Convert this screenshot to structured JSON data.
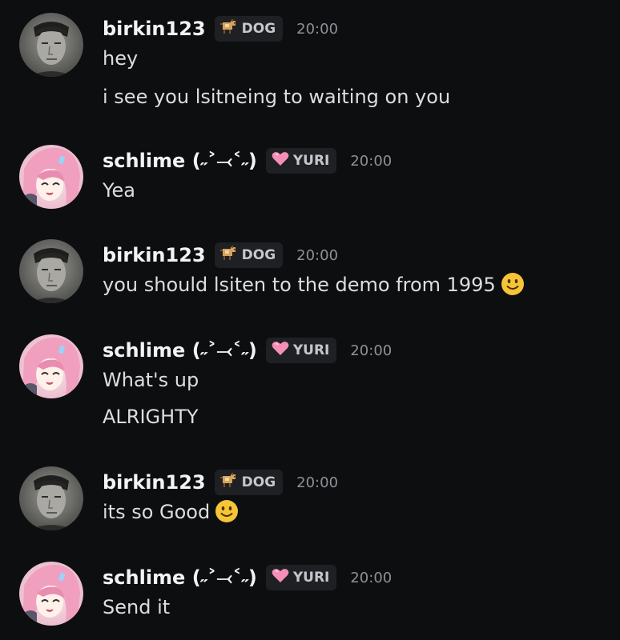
{
  "messages": [
    {
      "username": "birkin123",
      "tag": "DOG",
      "time": "20:00",
      "lines": [
        "hey",
        "i see you lsitneing to waiting on you"
      ]
    },
    {
      "username": "schlime (˶˃⤙˂˶)",
      "tag": "YURI",
      "time": "20:00",
      "lines": [
        "Yea"
      ]
    },
    {
      "username": "birkin123",
      "tag": "DOG",
      "time": "20:00",
      "lines": [
        "you should lsiten to the demo from 1995"
      ]
    },
    {
      "username": "schlime (˶˃⤙˂˶)",
      "tag": "YURI",
      "time": "20:00",
      "lines": [
        "What's up",
        "ALRIGHTY"
      ]
    },
    {
      "username": "birkin123",
      "tag": "DOG",
      "time": "20:00",
      "lines": [
        "its so Good"
      ]
    },
    {
      "username": "schlime (˶˃⤙˂˶)",
      "tag": "YURI",
      "time": "20:00",
      "lines": [
        "Send it"
      ]
    }
  ],
  "icons": {
    "dog_tag": "dog-icon",
    "yuri_tag": "pink-heart-icon",
    "emoji": "slightly-smiling-face-emoji"
  },
  "colors": {
    "background": "#0d0e10",
    "tag_background": "#1f2024",
    "heart": "#f58fb7",
    "dog": "#d7a25a",
    "emoji": "#f6c437"
  }
}
